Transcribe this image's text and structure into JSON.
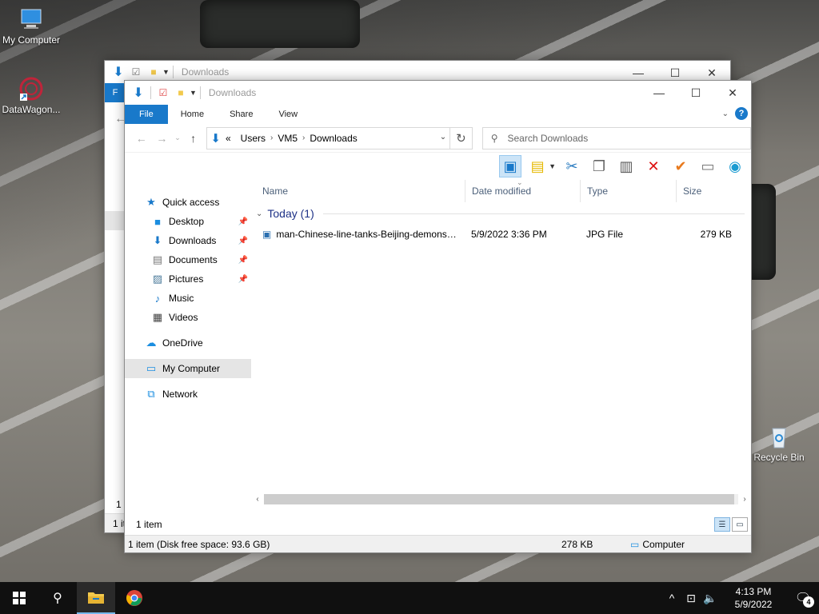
{
  "desktop": {
    "icons": [
      {
        "label": "My Computer"
      },
      {
        "label": "DataWagon..."
      },
      {
        "label": "Recycle Bin"
      }
    ]
  },
  "back_window": {
    "title": "Downloads",
    "file_tab_letter": "F",
    "status_items": "1 item",
    "status_partial": "1 ite"
  },
  "window": {
    "title": "Downloads",
    "ribbon_tabs": [
      "File",
      "Home",
      "Share",
      "View"
    ],
    "help": "?",
    "address": {
      "overflow": "«",
      "crumbs": [
        "Users",
        "VM5",
        "Downloads"
      ]
    },
    "search_placeholder": "Search Downloads",
    "nav": {
      "quick_access": "Quick access",
      "desktop": "Desktop",
      "downloads": "Downloads",
      "documents": "Documents",
      "pictures": "Pictures",
      "music": "Music",
      "videos": "Videos",
      "onedrive": "OneDrive",
      "my_computer": "My Computer",
      "network": "Network"
    },
    "columns": [
      "Name",
      "Date modified",
      "Type",
      "Size"
    ],
    "group": {
      "label": "Today (1)"
    },
    "files": [
      {
        "name": "man-Chinese-line-tanks-Beijing-demonstrators-Tiananmen-Square.jpg",
        "date": "5/9/2022 3:36 PM",
        "type": "JPG File",
        "size": "279 KB"
      }
    ],
    "status": {
      "items": "1 item"
    },
    "details": {
      "disk": "1 item (Disk free space: 93.6 GB)",
      "size": "278 KB",
      "location": "Computer"
    }
  },
  "taskbar": {
    "clock_time": "4:13 PM",
    "clock_date": "5/9/2022",
    "notification_count": "4"
  },
  "colors": {
    "accent": "#1979ca",
    "taskbar": "#101010",
    "group_header": "#1e3287"
  }
}
